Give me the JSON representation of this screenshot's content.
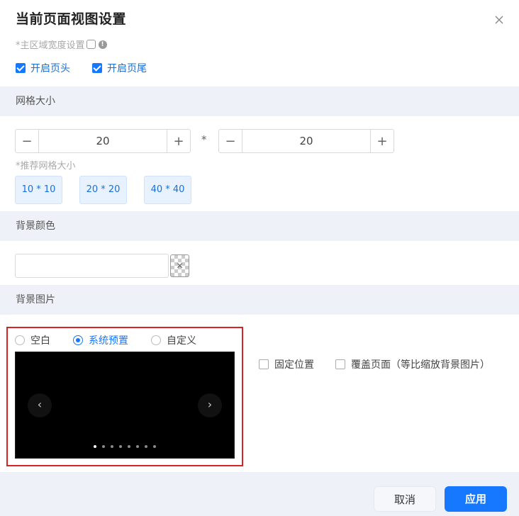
{
  "dialog": {
    "title": "当前页面视图设置"
  },
  "main_width": {
    "label": "*主区域宽度设置"
  },
  "header_footer": {
    "show_header": {
      "label": "开启页头",
      "checked": true
    },
    "show_footer": {
      "label": "开启页尾",
      "checked": true
    }
  },
  "grid_size": {
    "section_title": "网格大小",
    "width_value": "20",
    "separator": "*",
    "height_value": "20",
    "recommend_label": "*推荐网格大小",
    "presets": [
      "10 * 10",
      "20 * 20",
      "40 * 40"
    ]
  },
  "background_color": {
    "section_title": "背景颜色",
    "value": ""
  },
  "background_image": {
    "section_title": "背景图片",
    "options": [
      {
        "label": "空白",
        "selected": false
      },
      {
        "label": "系统预置",
        "selected": true
      },
      {
        "label": "自定义",
        "selected": false
      }
    ],
    "carousel": {
      "slide_count": 8,
      "active_index": 0,
      "prev_glyph": "‹",
      "next_glyph": "›"
    },
    "fixed_position": {
      "label": "固定位置",
      "checked": false
    },
    "cover_page": {
      "label": "覆盖页面（等比缩放背景图片）",
      "checked": false
    }
  },
  "footer": {
    "cancel_label": "取消",
    "apply_label": "应用"
  },
  "colors": {
    "primary": "#1677ff",
    "section_bg": "#eef2f8",
    "highlight": "#d62424"
  }
}
